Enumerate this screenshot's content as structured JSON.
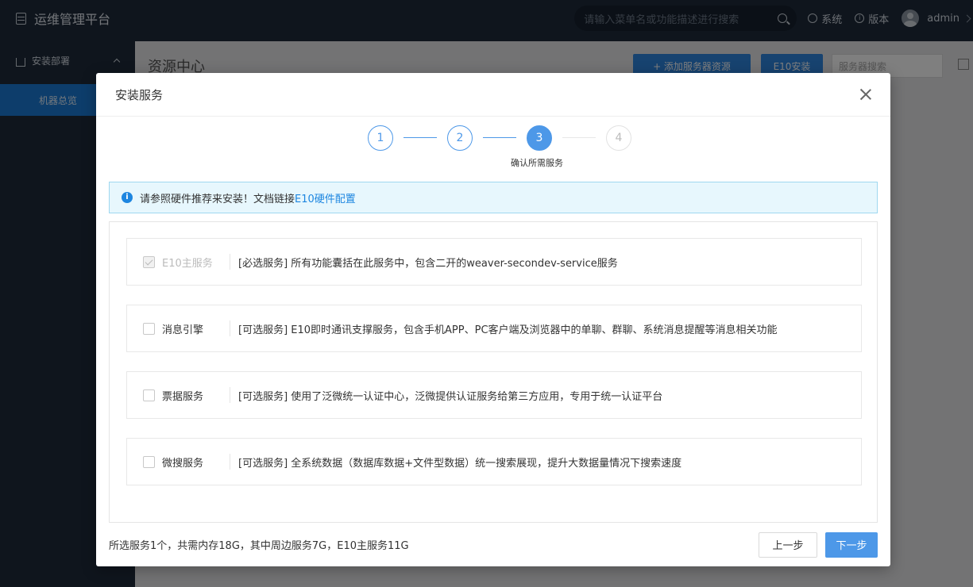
{
  "app": {
    "title": "运维管理平台",
    "search_placeholder": "请输入菜单名或功能描述进行搜索",
    "system_label": "系统",
    "version_label": "版本",
    "user_name": "admin"
  },
  "sidebar": {
    "group_label": "安装部署",
    "items": [
      {
        "label": "机器总览"
      }
    ]
  },
  "main": {
    "title": "资源中心",
    "add_server_label": "+ 添加服务器资源",
    "e10_install_label": "E10安装",
    "server_search_placeholder": "服务器搜索"
  },
  "modal": {
    "title": "安装服务",
    "steps": [
      {
        "num": "1",
        "status": "done"
      },
      {
        "num": "2",
        "status": "done"
      },
      {
        "num": "3",
        "status": "current",
        "label": "确认所需服务"
      },
      {
        "num": "4",
        "status": "todo"
      }
    ],
    "info_text": "请参照硬件推荐来安装！文档链接",
    "info_link": "E10硬件配置",
    "services": [
      {
        "name": "E10主服务",
        "checked": true,
        "disabled": true,
        "desc": "[必选服务] 所有功能囊括在此服务中，包含二开的weaver-secondev-service服务"
      },
      {
        "name": "消息引擎",
        "checked": false,
        "disabled": false,
        "desc": "[可选服务] E10即时通讯支撑服务，包含手机APP、PC客户端及浏览器中的单聊、群聊、系统消息提醒等消息相关功能"
      },
      {
        "name": "票据服务",
        "checked": false,
        "disabled": false,
        "desc": "[可选服务] 使用了泛微统一认证中心，泛微提供认证服务给第三方应用，专用于统一认证平台"
      },
      {
        "name": "微搜服务",
        "checked": false,
        "disabled": false,
        "desc": "[可选服务] 全系统数据（数据库数据+文件型数据）统一搜索展现，提升大数据量情况下搜索速度"
      }
    ],
    "footer_summary": "所选服务1个，共需内存18G，其中周边服务7G，E10主服务11G",
    "prev_label": "上一步",
    "next_label": "下一步"
  }
}
